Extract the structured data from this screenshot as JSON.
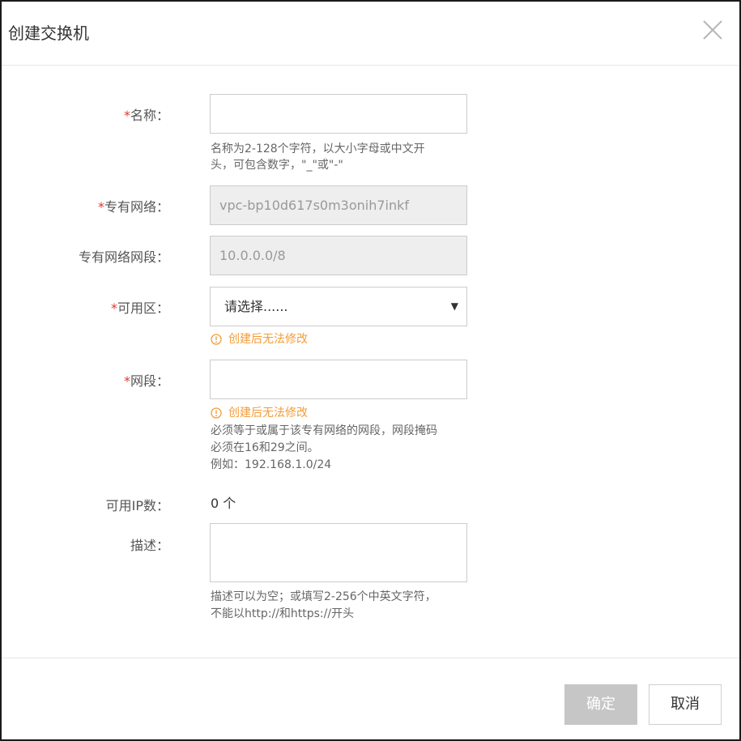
{
  "dialog": {
    "title": "创建交换机"
  },
  "form": {
    "required_mark": "*",
    "name": {
      "label": "名称：",
      "value": "",
      "hint_line1": "名称为2-128个字符，以大小字母或中文开",
      "hint_line2": "头，可包含数字，\"_\"或\"-\""
    },
    "vpc": {
      "label": "专有网络：",
      "value": "vpc-bp10d617s0m3onih7inkf"
    },
    "vpc_cidr": {
      "label": "专有网络网段：",
      "value": "10.0.0.0/8"
    },
    "zone": {
      "label": "可用区：",
      "selected": "请选择......",
      "caret": "▼",
      "warning": "创建后无法修改"
    },
    "cidr": {
      "label": "网段：",
      "value": "",
      "warning": "创建后无法修改",
      "hint_line1": "必须等于或属于该专有网络的网段，网段掩码",
      "hint_line2": "必须在16和29之间。",
      "hint_line3": "例如：192.168.1.0/24"
    },
    "available_ip": {
      "label": "可用IP数：",
      "value": "0 个"
    },
    "description": {
      "label": "描述：",
      "value": "",
      "hint_line1": "描述可以为空；或填写2-256个中英文字符，",
      "hint_line2": "不能以http://和https://开头"
    }
  },
  "footer": {
    "ok_label": "确定",
    "cancel_label": "取消"
  },
  "colors": {
    "required": "#e0392b",
    "warning": "#f39c38",
    "disabled_bg": "#eeeeee",
    "ok_button_bg": "#c6c6c6"
  },
  "icons": {
    "close": "close-icon",
    "warning": "warning-circle-icon",
    "caret": "caret-down-icon"
  }
}
